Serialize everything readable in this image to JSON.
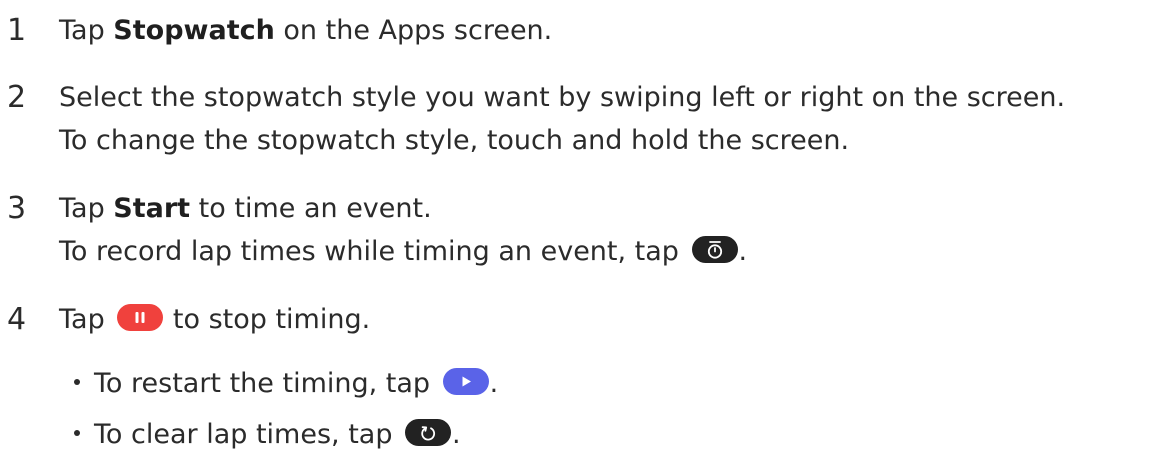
{
  "colors": {
    "text": "#2b2b2b",
    "dark_pill": "#222222",
    "pause_pill": "#f0413d",
    "play_pill": "#5a63e8"
  },
  "icons": {
    "lap": "stopwatch-lap-icon",
    "pause": "pause-icon",
    "play": "play-icon",
    "reset": "reset-icon"
  },
  "steps": [
    {
      "number": "1",
      "pre": "Tap ",
      "bold": "Stopwatch",
      "post": " on the Apps screen."
    },
    {
      "number": "2",
      "line1": "Select the stopwatch style you want by swiping left or right on the screen.",
      "line2": "To change the stopwatch style, touch and hold the screen."
    },
    {
      "number": "3",
      "pre": "Tap ",
      "bold": "Start",
      "post": " to time an event.",
      "line2_pre": "To record lap times while timing an event, tap ",
      "line2_post": "."
    },
    {
      "number": "4",
      "pre": "Tap ",
      "post": " to stop timing.",
      "bullets": [
        {
          "pre": "To restart the timing, tap ",
          "post": "."
        },
        {
          "pre": "To clear lap times, tap ",
          "post": "."
        }
      ]
    }
  ]
}
